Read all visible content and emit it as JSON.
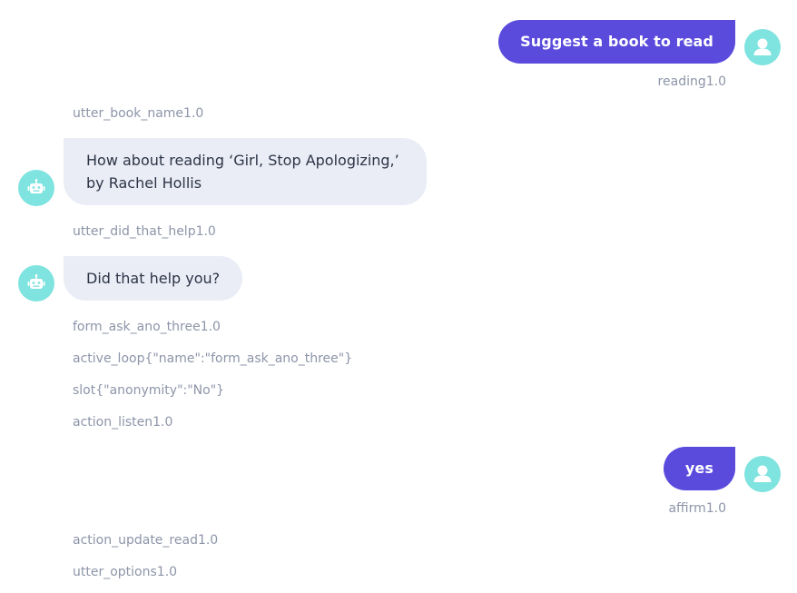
{
  "conversation": {
    "top_fragment": "",
    "user_message_1": "Suggest a book to read",
    "intent_1": "reading1.0",
    "action_1": "utter_book_name1.0",
    "bot_message_1": "How about reading ‘Girl, Stop Apologizing,’ by Rachel Hollis",
    "action_2": "utter_did_that_help1.0",
    "bot_message_2": "Did that help you?",
    "action_3": "form_ask_ano_three1.0",
    "action_4": "active_loop{\"name\":\"form_ask_ano_three\"}",
    "action_5": "slot{\"anonymity\":\"No\"}",
    "action_6": "action_listen1.0",
    "user_message_2": "yes",
    "intent_2": "affirm1.0",
    "action_7": "action_update_read1.0",
    "action_8": "utter_options1.0"
  },
  "colors": {
    "user_bubble": "#5a4bdd",
    "bot_bubble": "#eaedf6",
    "avatar": "#7fe3df",
    "meta_text": "#8d95a8"
  },
  "icons": {
    "user_avatar": "user-icon",
    "bot_avatar": "robot-icon"
  }
}
